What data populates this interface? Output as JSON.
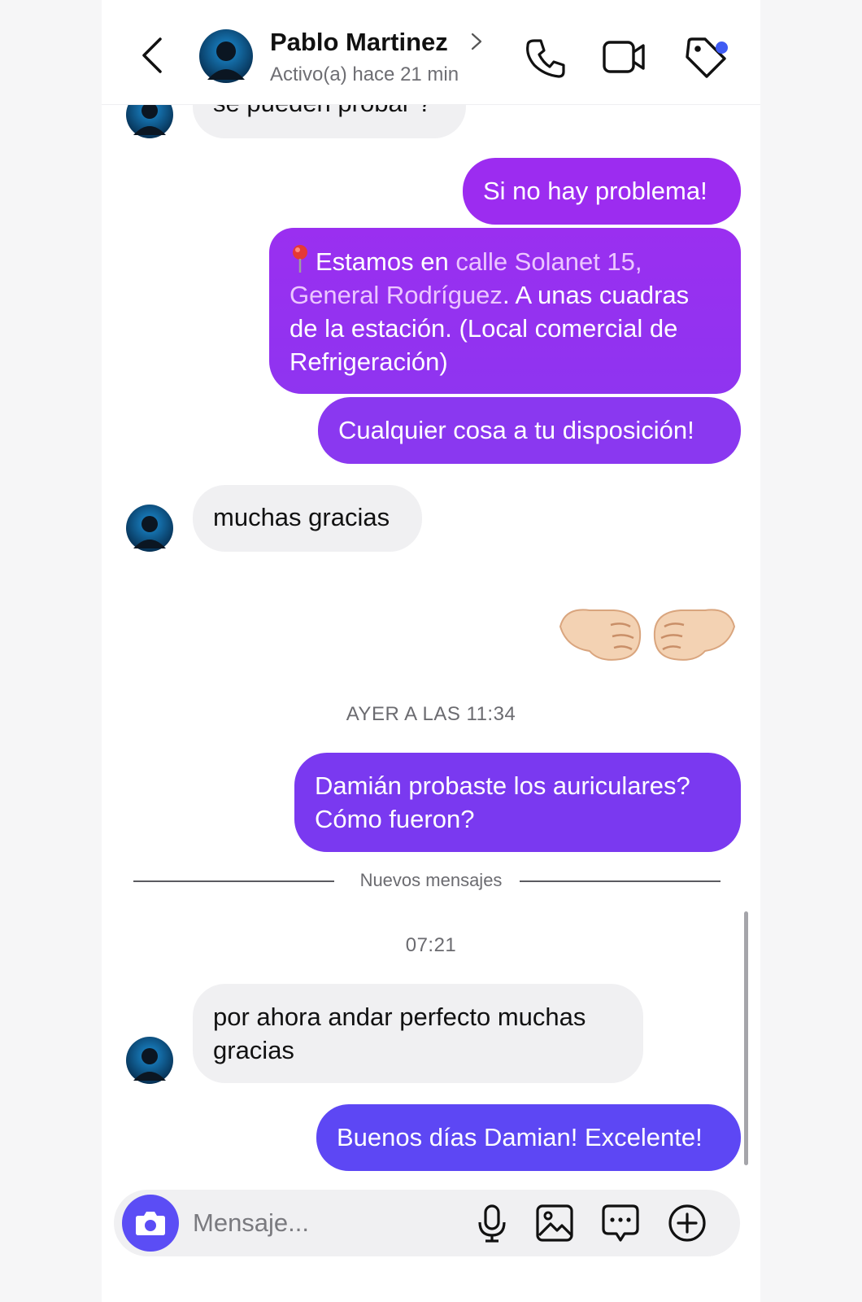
{
  "header": {
    "contact_name": "Pablo Martinez",
    "status": "Activo(a) hace 21 min"
  },
  "messages": {
    "m1": {
      "direction": "incoming",
      "text": "se pueden probar ?"
    },
    "m2": {
      "direction": "outgoing",
      "text": "Si no hay problema!"
    },
    "m3": {
      "direction": "outgoing",
      "pin_icon": "round-pushpin-icon",
      "lead": "Estamos en ",
      "address_link": "calle Solanet 15, General Rodríguez",
      "trail": ". A unas cuadras de la estación. (Local comercial de Refrigeración)"
    },
    "m4": {
      "direction": "outgoing",
      "text": "Cualquier cosa a tu disposición!"
    },
    "m5": {
      "direction": "incoming",
      "text": "muchas gracias"
    },
    "m6": {
      "direction": "outgoing",
      "emoji": "fist-bump",
      "glyphs": "🤛🤜"
    },
    "m7": {
      "direction": "outgoing",
      "text": "Damián probaste los auriculares? Cómo fueron?"
    },
    "m8": {
      "direction": "incoming",
      "text": "por ahora andar perfecto muchas gracias"
    },
    "m9": {
      "direction": "outgoing",
      "text": "Buenos días Damian! Excelente!"
    }
  },
  "timestamps": {
    "yesterday": "AYER A LAS 11:34",
    "today": "07:21"
  },
  "new_messages_divider": "Nuevos mensajes",
  "composer": {
    "placeholder": "Mensaje..."
  },
  "icons": {
    "back": "chevron-left-icon",
    "call": "phone-icon",
    "video": "video-camera-icon",
    "tag": "tag-icon",
    "camera": "camera-icon",
    "mic": "microphone-icon",
    "gallery": "image-icon",
    "sticker": "chat-bubble-icon",
    "plus": "plus-circle-icon"
  },
  "colors": {
    "bubble_purple": "#9a2ff0",
    "bubble_violet": "#7a39f0",
    "bubble_indigo": "#6a42f3",
    "bubble_blue_violet": "#5d47f4",
    "incoming_bubble": "#f0f0f2",
    "unread_dot": "#3f5bf3",
    "camera_button": "#5b4df5"
  }
}
